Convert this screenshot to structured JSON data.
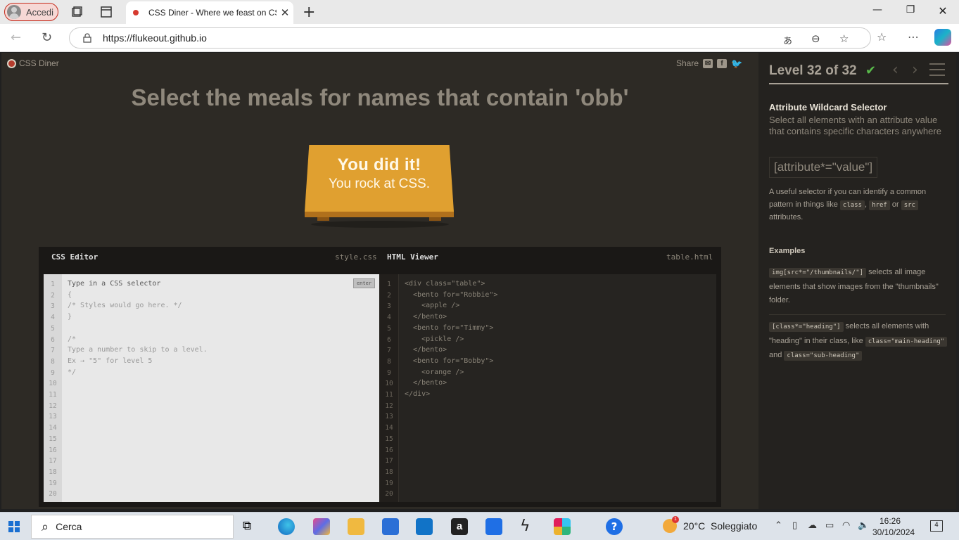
{
  "browser": {
    "profile_label": "Accedi",
    "tab_title": "CSS Diner - Where we feast on CSS",
    "url": "https://flukeout.github.io",
    "new_tab": "+"
  },
  "page": {
    "logo": "CSS Diner",
    "share_label": "Share",
    "instruction": "Select the meals for names that contain 'obb'",
    "win_title": "You did it!",
    "win_subtitle": "You rock at CSS.",
    "editor": {
      "css_title": "CSS Editor",
      "css_file": "style.css",
      "html_title": "HTML Viewer",
      "html_file": "table.html",
      "enter_label": "enter",
      "css_lines": [
        "Type in a CSS selector",
        "{",
        "/* Styles would go here. */",
        "}",
        "",
        "/*",
        "Type a number to skip to a level.",
        "Ex → \"5\" for level 5",
        "*/"
      ],
      "html_lines": [
        "<div class=\"table\">",
        "  <bento for=\"Robbie\">",
        "    <apple />",
        "  </bento>",
        "  <bento for=\"Timmy\">",
        "    <pickle />",
        "  </bento>",
        "  <bento for=\"Bobby\">",
        "    <orange />",
        "  </bento>",
        "</div>"
      ],
      "line_numbers": [
        "1",
        "2",
        "3",
        "4",
        "5",
        "6",
        "7",
        "8",
        "9",
        "10",
        "11",
        "12",
        "13",
        "14",
        "15",
        "16",
        "17",
        "18",
        "19",
        "20"
      ]
    }
  },
  "sidebar": {
    "level_text": "Level 32 of 32",
    "level_current": 32,
    "level_total": 32,
    "selector_name": "Attribute Wildcard Selector",
    "selector_title": "Select all elements with an attribute value that contains specific characters anywhere",
    "syntax": "[attribute*=\"value\"]",
    "hint_1": "A useful selector if you can identify a common pattern in things like",
    "hint_class": "class",
    "hint_href": "href",
    "hint_or": "or",
    "hint_src": "src",
    "hint_2": "attributes.",
    "examples_title": "Examples",
    "ex1_code": "img[src*=\"/thumbnails/\"]",
    "ex1_text": "selects all image elements that show images from the \"thumbnails\" folder.",
    "ex2_code": "[class*=\"heading\"]",
    "ex2_text_a": "selects all elements with \"heading\" in their class, like",
    "ex2_code_b": "class=\"main-heading\"",
    "ex2_and": "and",
    "ex2_code_c": "class=\"sub-heading\""
  },
  "taskbar": {
    "search_label": "Cerca",
    "weather": "20°C  Soleggiato",
    "weather_badge": "1",
    "time": "16:26",
    "date": "30/10/2024",
    "notifications": "4"
  },
  "colors": {
    "page_bg": "#2d2a25",
    "table": "#e0a030",
    "check": "#58b94a"
  }
}
